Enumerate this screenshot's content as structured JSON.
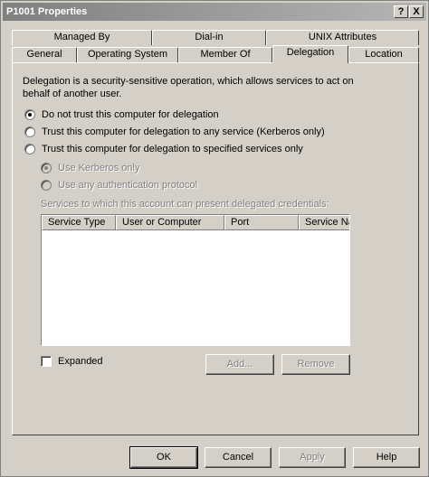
{
  "window": {
    "title": "P1001 Properties",
    "help_glyph": "?",
    "close_glyph": "X"
  },
  "tabs_row1": [
    {
      "label": "Managed By"
    },
    {
      "label": "Dial-in"
    },
    {
      "label": "UNIX Attributes"
    }
  ],
  "tabs_row2": [
    {
      "label": "General"
    },
    {
      "label": "Operating System"
    },
    {
      "label": "Member Of"
    },
    {
      "label": "Delegation"
    },
    {
      "label": "Location"
    }
  ],
  "delegation": {
    "description": "Delegation is a security-sensitive operation, which allows services to act on behalf of another user.",
    "options": [
      {
        "label": "Do not trust this computer for delegation",
        "selected": true
      },
      {
        "label": "Trust this computer for delegation to any service (Kerberos only)",
        "selected": false
      },
      {
        "label": "Trust this computer for delegation to specified services only",
        "selected": false
      }
    ],
    "sub_options": [
      {
        "label": "Use Kerberos only",
        "selected": true
      },
      {
        "label": "Use any authentication protocol",
        "selected": false
      }
    ],
    "services_label": "Services to which this account can present delegated credentials:",
    "columns": [
      "Service Type",
      "User or Computer",
      "Port",
      "Service Name"
    ],
    "expanded_label": "Expanded",
    "add_label": "Add...",
    "remove_label": "Remove"
  },
  "footer": {
    "ok": "OK",
    "cancel": "Cancel",
    "apply": "Apply",
    "help": "Help"
  }
}
